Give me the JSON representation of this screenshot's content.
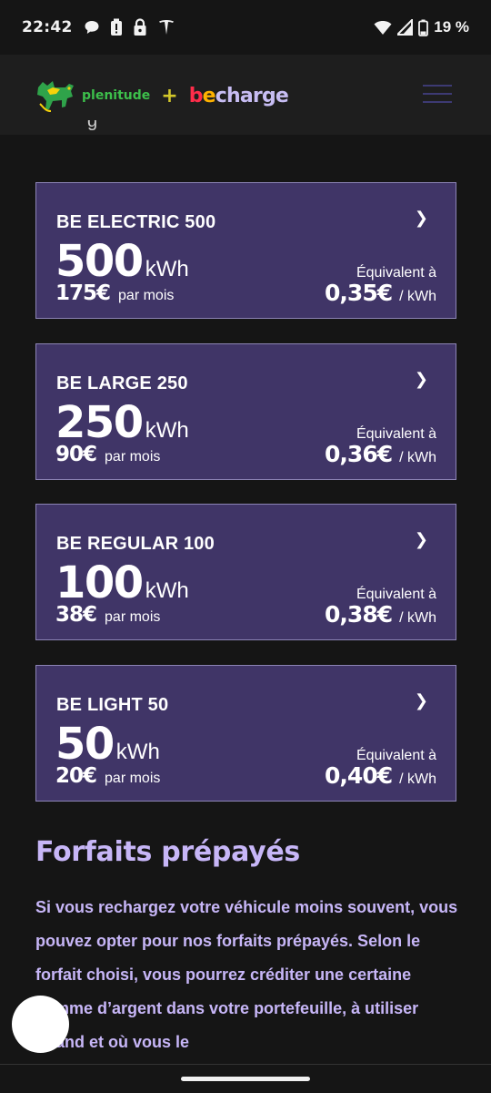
{
  "status_bar": {
    "time": "22:42",
    "battery": "19 %",
    "icons": [
      "chat-bubble-icon",
      "battery-alert-icon",
      "lock-icon",
      "tesla-icon",
      "wifi-icon",
      "signal-icon",
      "battery-icon"
    ]
  },
  "header": {
    "logo_plenitude": "plenitude",
    "logo_plus": "+",
    "logo_be_b": "b",
    "logo_be_e": "e",
    "logo_charge": "charge",
    "menu_icon": "hamburger-menu-icon"
  },
  "plans": [
    {
      "name": "BE ELECTRIC 500",
      "kwh": "500",
      "unit": "kWh",
      "price": "175€",
      "per": "par mois",
      "equiv": "Équivalent à",
      "kwh_price": "0,35€",
      "kwh_unit": "/ kWh",
      "chevron": "❯"
    },
    {
      "name": "BE LARGE 250",
      "kwh": "250",
      "unit": "kWh",
      "price": "90€",
      "per": "par mois",
      "equiv": "Équivalent à",
      "kwh_price": "0,36€",
      "kwh_unit": "/ kWh",
      "chevron": "❯"
    },
    {
      "name": "BE REGULAR 100",
      "kwh": "100",
      "unit": "kWh",
      "price": "38€",
      "per": "par mois",
      "equiv": "Équivalent à",
      "kwh_price": "0,38€",
      "kwh_unit": "/ kWh",
      "chevron": "❯"
    },
    {
      "name": "BE LIGHT 50",
      "kwh": "50",
      "unit": "kWh",
      "price": "20€",
      "per": "par mois",
      "equiv": "Équivalent à",
      "kwh_price": "0,40€",
      "kwh_unit": "/ kWh",
      "chevron": "❯"
    }
  ],
  "prepaid": {
    "title": "Forfaits prépayés",
    "body": "Si vous rechargez votre véhicule moins souvent, vous pouvez opter pour nos forfaits prépayés. Selon le forfait choisi, vous pourrez créditer une certaine somme d’argent dans votre portefeuille, à utiliser quand et où vous le"
  },
  "colors": {
    "background": "#151515",
    "card": "#403567",
    "card_border": "#8c84b5",
    "accent_text": "#c7b6f7"
  }
}
